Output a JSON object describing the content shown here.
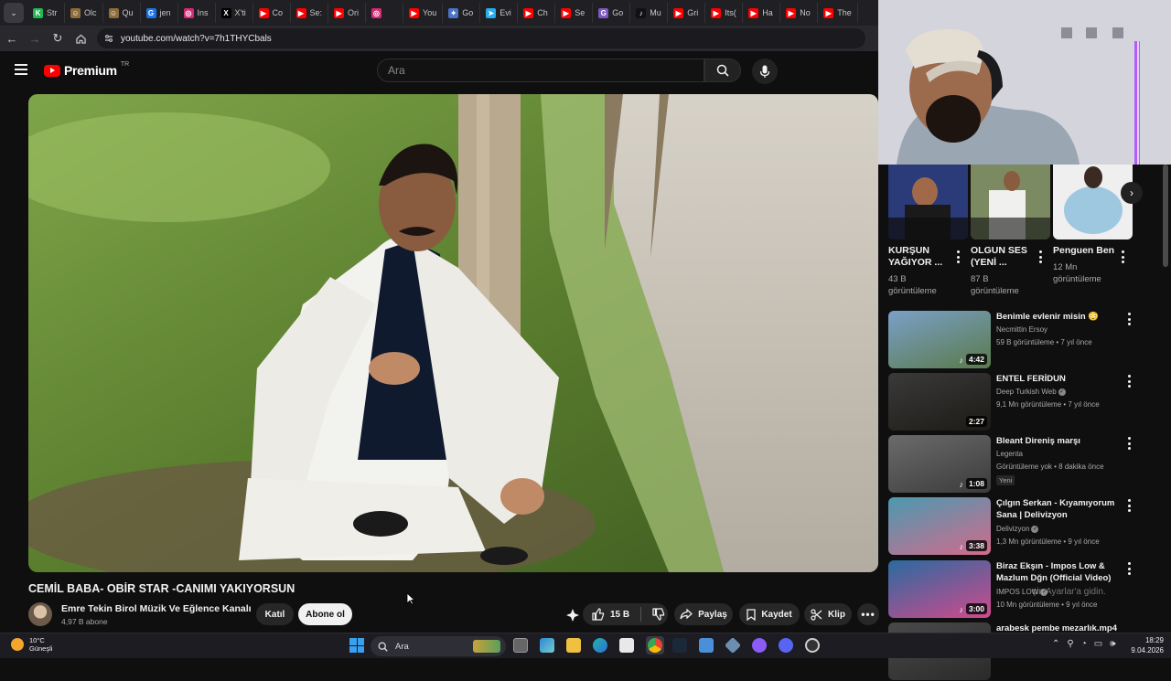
{
  "browser": {
    "tabs": [
      {
        "label": "Str",
        "color": "#1db954",
        "glyph": "K"
      },
      {
        "label": "Olc",
        "color": "#8c6d3c",
        "glyph": "☺"
      },
      {
        "label": "Qu",
        "color": "#8c6d3c",
        "glyph": "☺"
      },
      {
        "label": "jen",
        "color": "#1a73e8",
        "glyph": "G"
      },
      {
        "label": "Ins",
        "color": "#d62976",
        "glyph": "◎"
      },
      {
        "label": "X'ti",
        "color": "#000000",
        "glyph": "X"
      },
      {
        "label": "Co",
        "color": "#ff0000",
        "glyph": "▶"
      },
      {
        "label": "Se:",
        "color": "#ff0000",
        "glyph": "▶"
      },
      {
        "label": "Ori",
        "color": "#ff0000",
        "glyph": "▶"
      },
      {
        "label": "",
        "color": "#d62976",
        "glyph": "◎"
      },
      {
        "label": "You",
        "color": "#ff0000",
        "glyph": "▶"
      },
      {
        "label": "Go",
        "color": "#4a73c9",
        "glyph": "✦"
      },
      {
        "label": "Evi",
        "color": "#2aabee",
        "glyph": "➤"
      },
      {
        "label": "Ch",
        "color": "#ff0000",
        "glyph": "▶"
      },
      {
        "label": "Se",
        "color": "#ff0000",
        "glyph": "▶"
      },
      {
        "label": "Go",
        "color": "#7e57c2",
        "glyph": "G"
      },
      {
        "label": "Mu",
        "color": "#111111",
        "glyph": "♪"
      },
      {
        "label": "Gri",
        "color": "#ff0000",
        "glyph": "▶"
      },
      {
        "label": "Its(",
        "color": "#ff0000",
        "glyph": "▶"
      },
      {
        "label": "Ha",
        "color": "#ff0000",
        "glyph": "▶"
      },
      {
        "label": "No",
        "color": "#ff0000",
        "glyph": "▶"
      },
      {
        "label": "The",
        "color": "#ff0000",
        "glyph": "▶"
      }
    ],
    "url": "youtube.com/watch?v=7h1THYCbals"
  },
  "youtube": {
    "logo_text": "Premium",
    "country_code": "TR",
    "search_placeholder": "Ara"
  },
  "video": {
    "title": "CEMİL BABA- OBİR STAR -CANIMI YAKIYORSUN",
    "channel": "Emre Tekin Birol Müzik Ve Eğlence Kanalı",
    "subscribers": "4,97 B abone",
    "join_label": "Katıl",
    "subscribe_label": "Abone ol",
    "likes": "15 B",
    "share_label": "Paylaş",
    "save_label": "Kaydet",
    "clip_label": "Klip"
  },
  "shorts": [
    {
      "title": "KURŞUN YAĞIYOR ...",
      "views": "43 B görüntüleme"
    },
    {
      "title": "OLGUN SES (YENİ ...",
      "views": "87 B görüntüleme"
    },
    {
      "title": "Penguen Ben",
      "views": "12 Mn görüntüleme"
    }
  ],
  "recommended": [
    {
      "title": "Benimle evlenir misin 😳",
      "channel": "Necmittin Ersoy",
      "meta": "59 B görüntüleme • 7 yıl önce",
      "duration": "4:42",
      "music": true
    },
    {
      "title": "ENTEL FERİDUN",
      "channel": "Deep Turkish Web",
      "verified": true,
      "meta": "9,1 Mn görüntüleme • 7 yıl önce",
      "duration": "2:27",
      "music": false
    },
    {
      "title": "Bleant Direniş marşı",
      "channel": "Legenta",
      "meta": "Görüntüleme yok • 8 dakika önce",
      "badge": "Yeni",
      "duration": "1:08",
      "music": true
    },
    {
      "title": "Çılgın Serkan - Kıyamıyorum Sana | Delivizyon",
      "channel": "Delivizyon",
      "verified": true,
      "meta": "1,3 Mn görüntüleme • 9 yıl önce",
      "duration": "3:38",
      "music": true
    },
    {
      "title": "Biraz Ekşın - Impos Low & Mazlum Dğn (Official Video)",
      "channel": "IMPOS LOW",
      "verified": true,
      "meta": "10 Mn görüntüleme • 9 yıl önce",
      "duration": "3:00",
      "music": true
    },
    {
      "title": "arabesk pembe mezarlık.mp4",
      "channel": "",
      "meta": "",
      "duration": "",
      "music": false
    }
  ],
  "overlay_text": "çin Ayarlar'a gidin.",
  "taskbar": {
    "weather_temp": "10°C",
    "weather_desc": "Güneşli",
    "search_label": "Ara",
    "time": "18:29",
    "date": "9.04.2026"
  }
}
